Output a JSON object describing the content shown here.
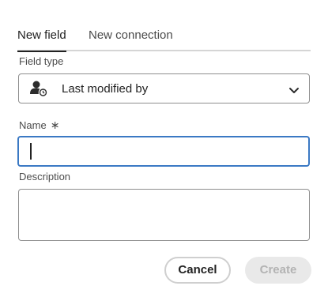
{
  "tabs": [
    {
      "label": "New field",
      "active": true
    },
    {
      "label": "New connection",
      "active": false
    }
  ],
  "field_type": {
    "label": "Field type",
    "value": "Last modified by",
    "icon": "user-clock-icon"
  },
  "name": {
    "label": "Name",
    "required_marker": "∗",
    "value": ""
  },
  "description": {
    "label": "Description",
    "value": ""
  },
  "actions": {
    "cancel_label": "Cancel",
    "create_label": "Create"
  },
  "colors": {
    "focus_border": "#3b79c4",
    "border": "#8e8e8e",
    "tab_underline": "#d5d5d5",
    "disabled_bg": "#e9e9e9",
    "disabled_text": "#b3b3b3"
  }
}
